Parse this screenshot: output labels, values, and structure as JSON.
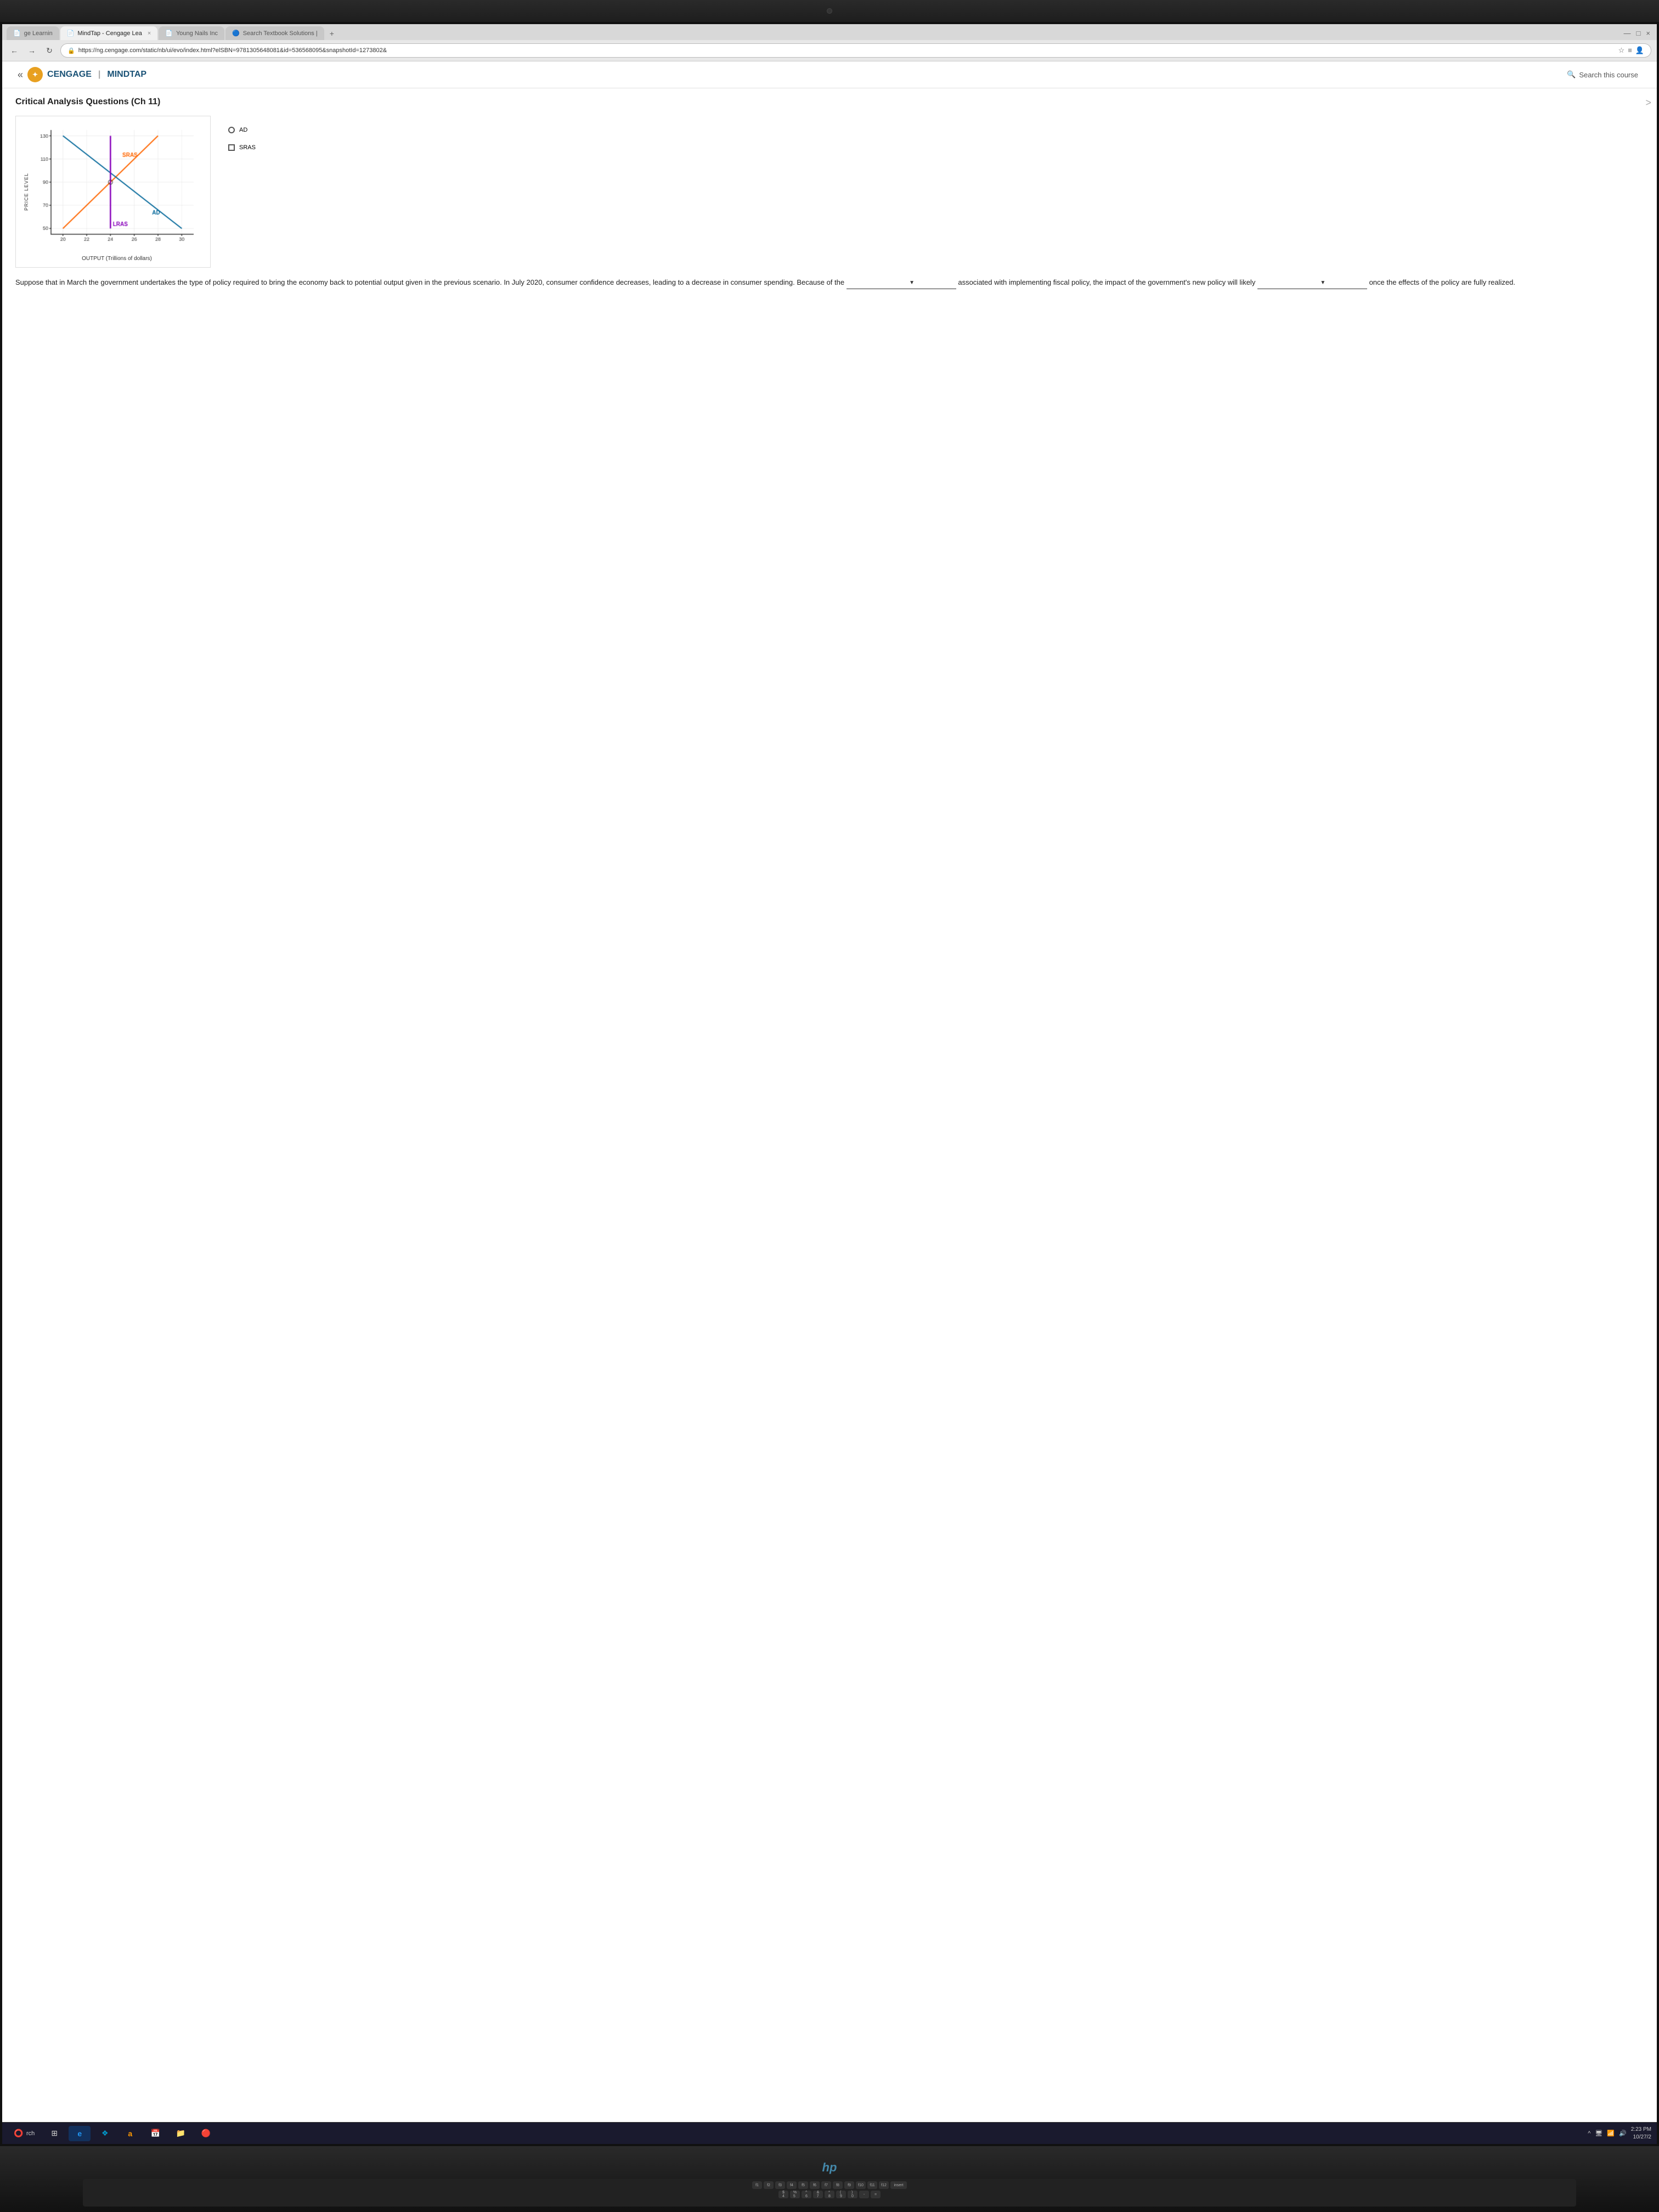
{
  "browser": {
    "tabs": [
      {
        "label": "ge Learnin",
        "active": false,
        "icon": "📄"
      },
      {
        "label": "MindTap - Cengage Lea",
        "active": true,
        "icon": "📄"
      },
      {
        "label": "Young Nails Inc",
        "active": false,
        "icon": "📄"
      },
      {
        "label": "Search Textbook Solutions |",
        "active": false,
        "icon": "🔵"
      }
    ],
    "url": "https://ng.cengage.com/static/nb/ui/evo/index.html?elSBN=9781305648081&id=536568095&snapshotId=1273802&",
    "tab_close": "×",
    "add_tab": "+"
  },
  "header": {
    "logo": "✦",
    "brand": "CENGAGE",
    "divider": "|",
    "product": "MINDTAP",
    "search_label": "Search this course"
  },
  "page": {
    "title": "Critical Analysis Questions (Ch 11)",
    "close_icon": ">"
  },
  "chart": {
    "y_axis_label": "PRICE LEVEL",
    "x_axis_label": "OUTPUT (Trillions of dollars)",
    "y_min": 50,
    "y_max": 130,
    "y_ticks": [
      50,
      70,
      90,
      110,
      130
    ],
    "x_ticks": [
      20,
      22,
      24,
      26,
      28,
      30
    ],
    "lines": {
      "SRAS": {
        "color": "#ff6600",
        "label": "SRAS"
      },
      "AD": {
        "color": "#006699",
        "label": "AD"
      },
      "LRAS": {
        "color": "#9900cc",
        "label": "LRAS"
      }
    }
  },
  "legend": {
    "items": [
      {
        "label": "AD",
        "type": "circle"
      },
      {
        "label": "SRAS",
        "type": "square"
      }
    ]
  },
  "question": {
    "text1": "Suppose that in March the government undertakes the type of policy required to bring the economy back to potential output given in the previous scenario. In July 2020, consumer confidence decreases, leading to a decrease in consumer spending. Because of the",
    "blank1": "",
    "text2": "associated with implementing fiscal policy, the impact of the government's new policy will likely",
    "blank2": "",
    "text3": "once the effects of the policy are fully realized."
  },
  "taskbar": {
    "search_text": "rch",
    "items": [
      {
        "icon": "⭕",
        "label": ""
      },
      {
        "icon": "⊞",
        "label": ""
      },
      {
        "icon": "e",
        "label": "",
        "active": false
      },
      {
        "icon": "❖",
        "label": ""
      },
      {
        "icon": "a",
        "label": ""
      },
      {
        "icon": "📅",
        "label": ""
      },
      {
        "icon": "📁",
        "label": ""
      },
      {
        "icon": "🔴",
        "label": ""
      }
    ],
    "time": "2:23 PM",
    "date": "10/27/2"
  },
  "nav": {
    "collapse_left": "«",
    "collapse_right": ">"
  }
}
